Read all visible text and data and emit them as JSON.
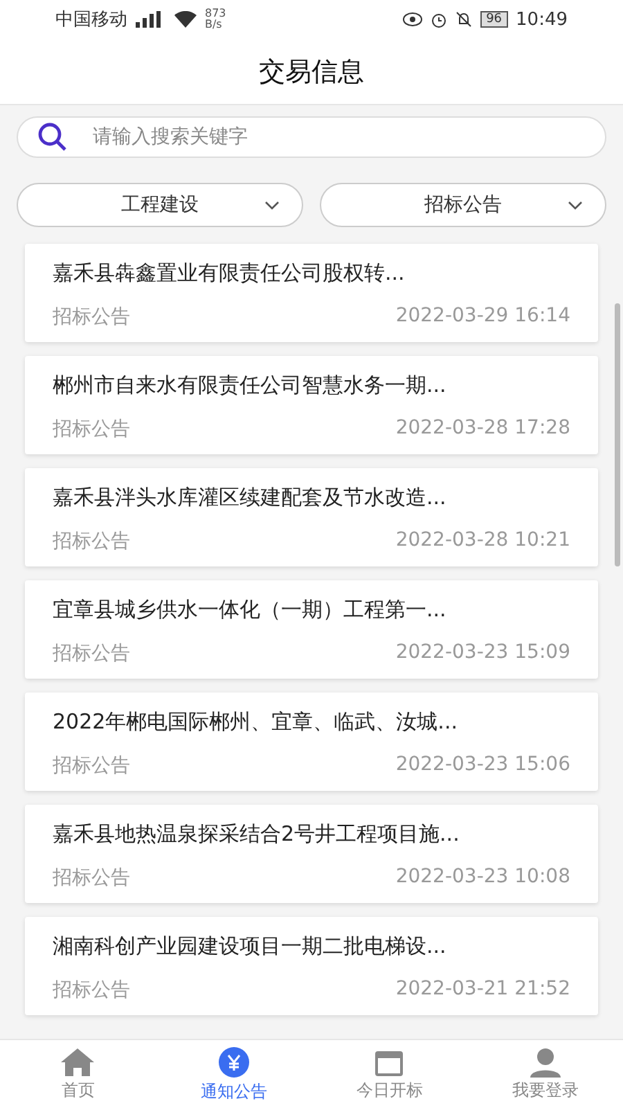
{
  "status_bar": {
    "carrier": "中国移动",
    "speed_value": "873",
    "speed_unit": "B/s",
    "battery": "96",
    "time": "10:49"
  },
  "title": "交易信息",
  "search": {
    "placeholder": "请输入搜索关键字"
  },
  "filters": [
    {
      "label": "工程建设"
    },
    {
      "label": "招标公告"
    }
  ],
  "items": [
    {
      "title": "嘉禾县犇鑫置业有限责任公司股权转...",
      "category": "招标公告",
      "date": "2022-03-29 16:14"
    },
    {
      "title": "郴州市自来水有限责任公司智慧水务一期...",
      "category": "招标公告",
      "date": "2022-03-28 17:28"
    },
    {
      "title": "嘉禾县泮头水库灌区续建配套及节水改造...",
      "category": "招标公告",
      "date": "2022-03-28 10:21"
    },
    {
      "title": "宜章县城乡供水一体化（一期）工程第一...",
      "category": "招标公告",
      "date": "2022-03-23 15:09"
    },
    {
      "title": "2022年郴电国际郴州、宜章、临武、汝城...",
      "category": "招标公告",
      "date": "2022-03-23 15:06"
    },
    {
      "title": "嘉禾县地热温泉探采结合2号井工程项目施...",
      "category": "招标公告",
      "date": "2022-03-23 10:08"
    },
    {
      "title": "湘南科创产业园建设项目一期二批电梯设...",
      "category": "招标公告",
      "date": "2022-03-21 21:52"
    }
  ],
  "nav": [
    {
      "label": "首页",
      "kind": "home",
      "selected": false
    },
    {
      "label": "通知公告",
      "kind": "notice",
      "selected": true
    },
    {
      "label": "今日开标",
      "kind": "today",
      "selected": false
    },
    {
      "label": "我要登录",
      "kind": "login",
      "selected": false
    }
  ]
}
